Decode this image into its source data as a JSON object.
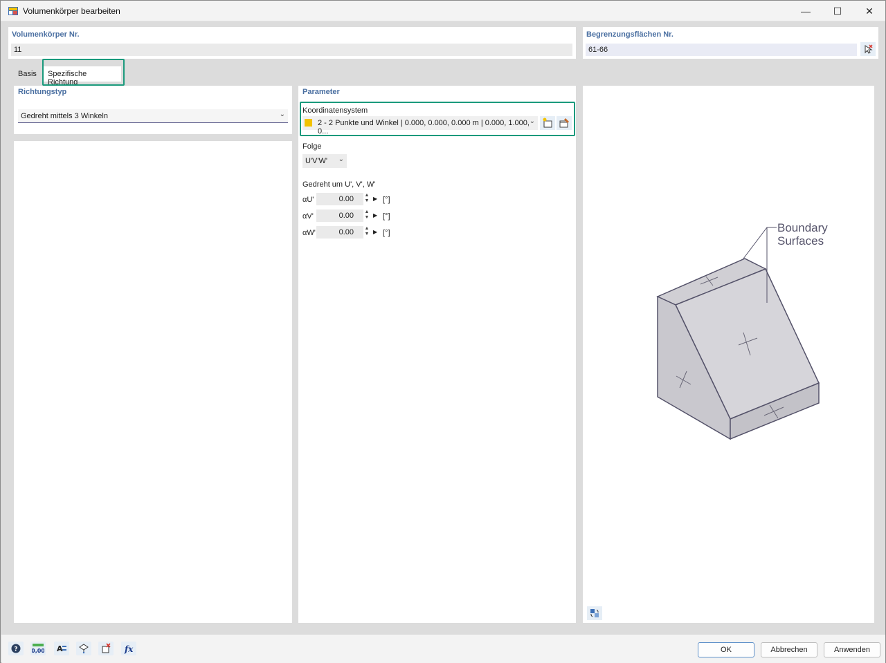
{
  "window": {
    "title": "Volumenkörper bearbeiten",
    "minimize_glyph": "—",
    "maximize_glyph": "☐",
    "close_glyph": "✕"
  },
  "header": {
    "solid_label": "Volumenkörper Nr.",
    "solid_value": "11",
    "surfaces_label": "Begrenzungsflächen Nr.",
    "surfaces_value": "61-66"
  },
  "tabs": [
    {
      "label": "Basis",
      "active": false
    },
    {
      "label": "Spezifische Richtung",
      "active": true
    }
  ],
  "direction": {
    "label": "Richtungstyp",
    "value": "Gedreht mittels 3 Winkeln"
  },
  "parameter": {
    "label": "Parameter",
    "coord_label": "Koordinatensystem",
    "coord_value": "2 - 2 Punkte und Winkel | 0.000, 0.000, 0.000 m | 0.000, 1.000, 0...",
    "coord_color": "#f2c200",
    "sequence_label": "Folge",
    "sequence_value": "U'V'W'",
    "rotated_label": "Gedreht um U', V', W'",
    "angles": [
      {
        "label": "αU'",
        "value": "0.00",
        "unit": "[°]"
      },
      {
        "label": "αV'",
        "value": "0.00",
        "unit": "[°]"
      },
      {
        "label": "αW'",
        "value": "0.00",
        "unit": "[°]"
      }
    ]
  },
  "diagram": {
    "annotation_line1": "Boundary",
    "annotation_line2": "Surfaces"
  },
  "buttons": {
    "ok": "OK",
    "cancel": "Abbrechen",
    "apply": "Anwenden"
  },
  "footer_icons": [
    "help-icon",
    "units-icon",
    "text-format-icon",
    "model-view-icon",
    "delete-select-icon",
    "function-icon"
  ],
  "colors": {
    "highlight": "#1a9a7c",
    "section_label": "#4a6fa1"
  }
}
